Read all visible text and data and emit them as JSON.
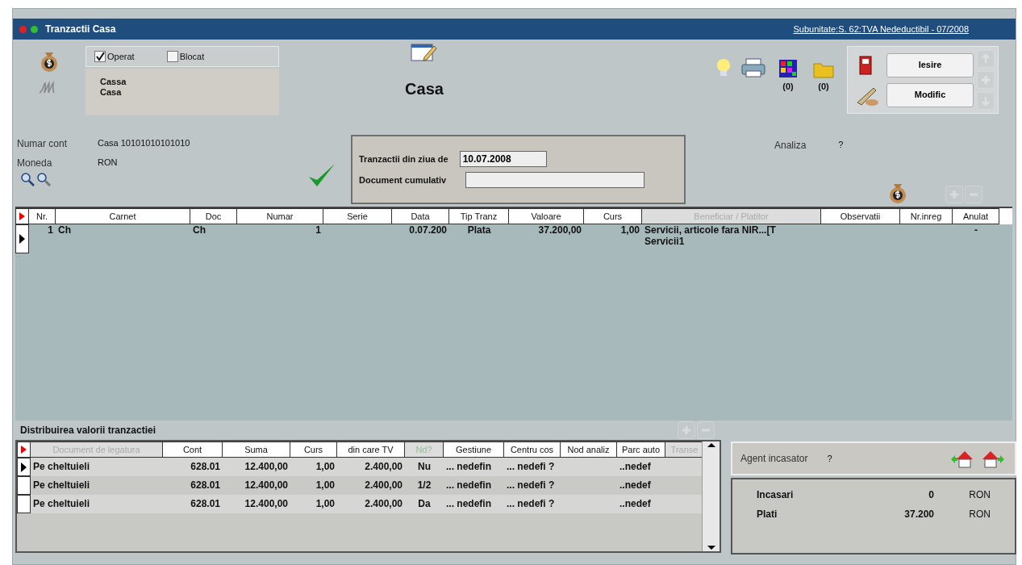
{
  "window": {
    "title": "Tranzactii Casa",
    "context_link": "Subunitate:S. 62:TVA Nedeductibil - 07/2008"
  },
  "flags": [
    {
      "label": "Operat",
      "checked": true
    },
    {
      "label": "Blocat",
      "checked": false
    }
  ],
  "cash_register": {
    "code": "Cassa",
    "name": "Casa"
  },
  "heading": "Casa",
  "counters": [
    {
      "kind": "cube",
      "count": "(0)"
    },
    {
      "kind": "folder",
      "count": "(0)"
    }
  ],
  "buttons": [
    {
      "kind": "exit",
      "label": "Iesire"
    },
    {
      "kind": "edit",
      "label": "Modific"
    }
  ],
  "record_buttons": [
    {
      "kind": "up",
      "disabled": true
    },
    {
      "kind": "plus",
      "disabled": true
    },
    {
      "kind": "down",
      "disabled": true
    }
  ],
  "fields": [
    {
      "label": "Numar cont",
      "value": "Casa 10101010101010"
    },
    {
      "label": "Moneda",
      "value": "RON"
    }
  ],
  "filter": {
    "date_label": "Tranzactii din ziua de",
    "date": "10.07.2008",
    "cumulative_label": "Document cumulativ"
  },
  "analysis": {
    "label": "Analiza",
    "value": "?"
  },
  "transactions": {
    "buttons": [
      {
        "kind": "plus",
        "disabled": true
      },
      {
        "kind": "minus",
        "disabled": true
      }
    ],
    "columns": [
      {
        "label": "Nr.",
        "disabled": false
      },
      {
        "label": "Carnet",
        "disabled": false
      },
      {
        "label": "Doc",
        "disabled": false
      },
      {
        "label": "Numar",
        "disabled": false
      },
      {
        "label": "Serie",
        "disabled": false
      },
      {
        "label": "Data",
        "disabled": false
      },
      {
        "label": "Tip Tranz",
        "disabled": false
      },
      {
        "label": "Valoare",
        "disabled": false
      },
      {
        "label": "Curs",
        "disabled": false
      },
      {
        "label": "Beneficiar / Platitor",
        "disabled": true
      },
      {
        "label": "Observatii",
        "disabled": false
      },
      {
        "label": "Nr.inreg",
        "disabled": false
      },
      {
        "label": "Anulat",
        "disabled": false
      }
    ],
    "rows": [
      {
        "selected": true,
        "cells": [
          "1",
          "Ch",
          "Ch",
          "1",
          "",
          "0.07.200",
          "Plata",
          "37.200,00",
          "1,00",
          "Servicii, articole fara NIR...[T\nServicii1",
          "",
          "",
          "-"
        ]
      }
    ]
  },
  "distribution": {
    "title": "Distribuirea valorii tranzactiei",
    "buttons": [
      {
        "kind": "plus",
        "disabled": true
      },
      {
        "kind": "minus",
        "disabled": true
      }
    ],
    "columns": [
      {
        "label": "Document de legatura",
        "disabled": true
      },
      {
        "label": "Cont",
        "disabled": false
      },
      {
        "label": "Suma",
        "disabled": false
      },
      {
        "label": "Curs",
        "disabled": false
      },
      {
        "label": "din care TV",
        "disabled": false
      },
      {
        "label": "Nd?",
        "disabled": true
      },
      {
        "label": "Gestiune",
        "disabled": false
      },
      {
        "label": "Centru cos",
        "disabled": false
      },
      {
        "label": "Nod analiz",
        "disabled": false
      },
      {
        "label": "Parc auto",
        "disabled": false
      },
      {
        "label": "Transe",
        "disabled": true
      }
    ],
    "rows": [
      {
        "selected": true,
        "cells": [
          "Pe cheltuieli",
          "628.01",
          "12.400,00",
          "1,00",
          "2.400,00",
          "Nu",
          "... nedefin",
          "... nedefi ?",
          "",
          "..nedef",
          ""
        ]
      },
      {
        "selected": false,
        "cells": [
          "Pe cheltuieli",
          "628.01",
          "12.400,00",
          "1,00",
          "2.400,00",
          "1/2",
          "... nedefin",
          "... nedefi ?",
          "",
          "..nedef",
          ""
        ]
      },
      {
        "selected": false,
        "cells": [
          "Pe cheltuieli",
          "628.01",
          "12.400,00",
          "1,00",
          "2.400,00",
          "Da",
          "... nedefin",
          "... nedefi ?",
          "",
          "..nedef",
          ""
        ]
      }
    ]
  },
  "agent": {
    "label": "Agent incasator",
    "value": "?"
  },
  "totals": [
    {
      "label": "Incasari",
      "amount": "0",
      "currency": "RON"
    },
    {
      "label": "Plati",
      "amount": "37.200",
      "currency": "RON"
    }
  ]
}
